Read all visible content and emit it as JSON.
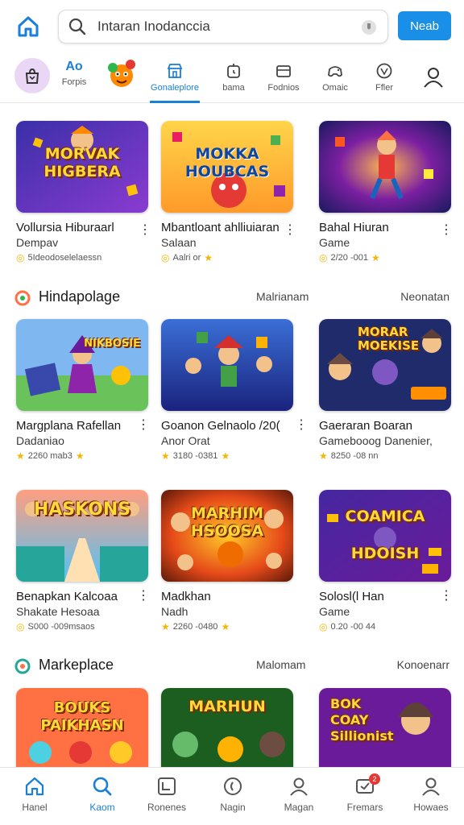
{
  "search": {
    "value": "Intaran Inodanccia"
  },
  "header": {
    "cta_label": "Neab"
  },
  "tabs": {
    "featured": {
      "big": "Ao",
      "small": "Forpis"
    },
    "items": [
      {
        "label": "Gonaleplore",
        "icon": "store-icon",
        "active": true
      },
      {
        "label": "bama",
        "icon": "timer-icon"
      },
      {
        "label": "Fodnios",
        "icon": "wallet-icon"
      },
      {
        "label": "Omaic",
        "icon": "gamepad-icon"
      },
      {
        "label": "Ffler",
        "icon": "filter-icon"
      },
      {
        "label": "",
        "icon": "user-icon"
      }
    ]
  },
  "sections": [
    {
      "title": "Hindapolage",
      "mid": "Malrianam",
      "right": "Neonatan"
    },
    {
      "title": "Markeplace",
      "mid": "Malomam",
      "right": "Konoenarr"
    }
  ],
  "rows": [
    [
      {
        "art_title": "MORVAK HIGBERA",
        "name": "Vollursia Hiburaarl",
        "sub": "Dempav",
        "meta": "5Ideodoselelaessn",
        "meta_prefix_icon": "coin-icon"
      },
      {
        "art_title": "MOKKA HOUBCAS",
        "name": "Mbantloant ahlliuiaran",
        "sub": "Salaan",
        "meta": "Aalri or",
        "meta_prefix_icon": "coin-icon"
      },
      {
        "art_title": "",
        "name": "Bahal Hiuran",
        "sub": "Game",
        "meta": "2/20 -001",
        "meta_prefix_icon": "coin-icon"
      }
    ],
    [
      {
        "art_title": "NIKBOSIE",
        "name": "Margplana Rafellan",
        "sub": "Dadaniao",
        "meta": "2260 mab3"
      },
      {
        "art_title": "",
        "name": "Goanon Gelnaolo /20(",
        "sub": "Anor Orat",
        "meta": "3180 -0381"
      },
      {
        "art_title": "MORAR MOEKISE",
        "name": "Gaeraran Boaran",
        "sub": "Gamebooog Danenier,",
        "meta": "8250 -08 nn"
      }
    ],
    [
      {
        "art_title": "HASKONS",
        "name": "Benapkan Kalcoaa",
        "sub": "Shakate Hesoaa",
        "meta": "S000 -009msaos",
        "meta_prefix_icon": "coin-icon"
      },
      {
        "art_title": "MARHIM HSOOSA",
        "name": "Madkhan",
        "sub": "Nadh",
        "meta": "2260 -0480"
      },
      {
        "art_title": "COAMICA HDOISH",
        "name": "Solosl(l Han",
        "sub": "Game",
        "meta": "0.20 -00 44",
        "meta_prefix_icon": "coin-icon"
      }
    ],
    [
      {
        "art_title": "BOUKS PAIKHASN",
        "name": "",
        "sub": "",
        "meta": ""
      },
      {
        "art_title": "MARHUN",
        "name": "",
        "sub": "",
        "meta": ""
      },
      {
        "art_title": "BOK COAY Sillionist",
        "name": "",
        "sub": "",
        "meta": ""
      }
    ]
  ],
  "bottom_nav": [
    {
      "label": "Hanel",
      "icon": "home-icon"
    },
    {
      "label": "Kaom",
      "icon": "search-icon",
      "active": true
    },
    {
      "label": "Ronenes",
      "icon": "library-icon"
    },
    {
      "label": "Nagin",
      "icon": "compass-icon"
    },
    {
      "label": "Magan",
      "icon": "user-icon"
    },
    {
      "label": "Fremars",
      "icon": "ticket-icon",
      "badge": "2"
    },
    {
      "label": "Howaes",
      "icon": "profile-icon"
    }
  ],
  "colors": {
    "accent": "#1a8fe8"
  }
}
